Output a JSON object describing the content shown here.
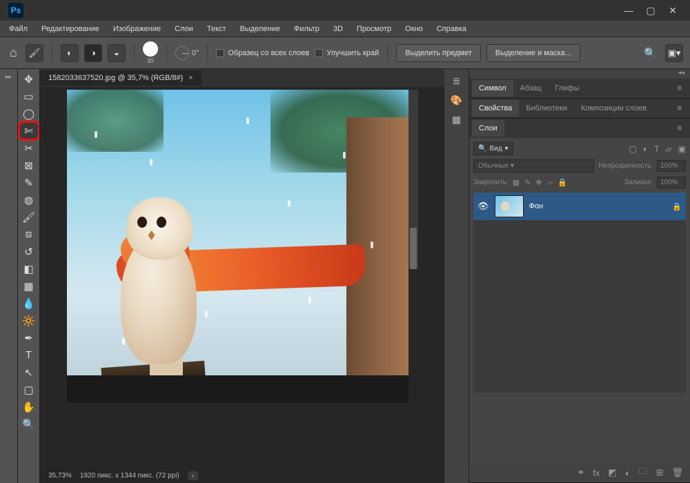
{
  "menubar": [
    "Файл",
    "Редактирование",
    "Изображение",
    "Слои",
    "Текст",
    "Выделение",
    "Фильтр",
    "3D",
    "Просмотр",
    "Окно",
    "Справка"
  ],
  "optbar": {
    "brush_size": "30",
    "angle": "0°",
    "chk_sample": "Образец со всех слоев",
    "chk_enhance": "Улучшить край",
    "btn_select_subject": "Выделить предмет",
    "btn_select_mask": "Выделение и маска..."
  },
  "doc": {
    "tab": "1582033637520.jpg @ 35,7% (RGB/8#)",
    "zoom": "35,73%",
    "dims": "1920 пикс. x 1344 пикс. (72 ppi)"
  },
  "panels": {
    "char_tabs": [
      "Символ",
      "Абзац",
      "Глифы"
    ],
    "prop_tabs": [
      "Свойства",
      "Библиотеки",
      "Композиции слоев"
    ],
    "layers_tab": "Слои",
    "filter_label": "Вид",
    "blend_mode": "Обычные",
    "opacity_label": "Непрозрачность:",
    "opacity_val": "100%",
    "lock_label": "Закрепить:",
    "fill_label": "Заливка:",
    "fill_val": "100%",
    "layer_name": "Фон"
  }
}
